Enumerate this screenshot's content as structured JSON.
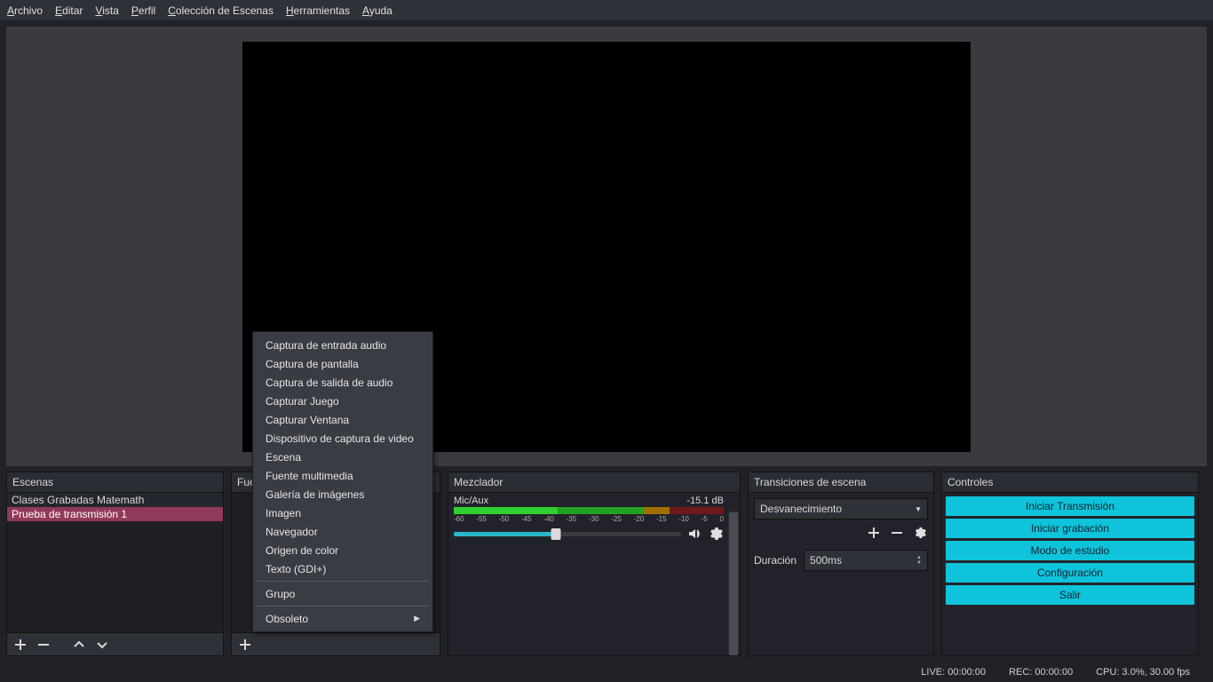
{
  "menu": {
    "items": [
      {
        "pre": "A",
        "rest": "rchivo"
      },
      {
        "pre": "E",
        "rest": "ditar"
      },
      {
        "pre": "V",
        "rest": "ista"
      },
      {
        "pre": "P",
        "rest": "erfil"
      },
      {
        "pre": "C",
        "rest": "olección de Escenas"
      },
      {
        "pre": "H",
        "rest": "erramientas"
      },
      {
        "pre": "A",
        "rest": "yuda"
      }
    ]
  },
  "panels": {
    "scenes": {
      "title": "Escenas"
    },
    "sources": {
      "title": "Fuentes"
    },
    "mixer": {
      "title": "Mezclador"
    },
    "transitions": {
      "title": "Transiciones de escena"
    },
    "controls": {
      "title": "Controles"
    }
  },
  "scenes": {
    "items": [
      {
        "label": "Clases Grabadas Matemath",
        "selected": false
      },
      {
        "label": "Prueba de transmisión 1",
        "selected": true
      }
    ]
  },
  "context_menu": {
    "items": [
      "Captura de entrada audio",
      "Captura de pantalla",
      "Captura de salida de audio",
      "Capturar Juego",
      "Capturar Ventana",
      "Dispositivo de captura de video",
      "Escena",
      "Fuente multimedia",
      "Galería de imágenes",
      "Imagen",
      "Navegador",
      "Origen de color",
      "Texto (GDI+)"
    ],
    "group": "Grupo",
    "deprecated": "Obsoleto"
  },
  "mixer": {
    "channel": {
      "name": "Mic/Aux",
      "db": "-15.1 dB",
      "ticks": [
        "-60",
        "-55",
        "-50",
        "-45",
        "-40",
        "-35",
        "-30",
        "-25",
        "-20",
        "-15",
        "-10",
        "-5",
        "0"
      ]
    }
  },
  "transitions": {
    "selected": "Desvanecimiento",
    "duration_label": "Duración",
    "duration_value": "500ms"
  },
  "controls": {
    "buttons": [
      "Iniciar Transmisión",
      "Iniciar grabación",
      "Modo de estudio",
      "Configuración",
      "Salir"
    ]
  },
  "statusbar": {
    "live": "LIVE: 00:00:00",
    "rec": "REC: 00:00:00",
    "cpu": "CPU: 3.0%, 30.00 fps"
  }
}
